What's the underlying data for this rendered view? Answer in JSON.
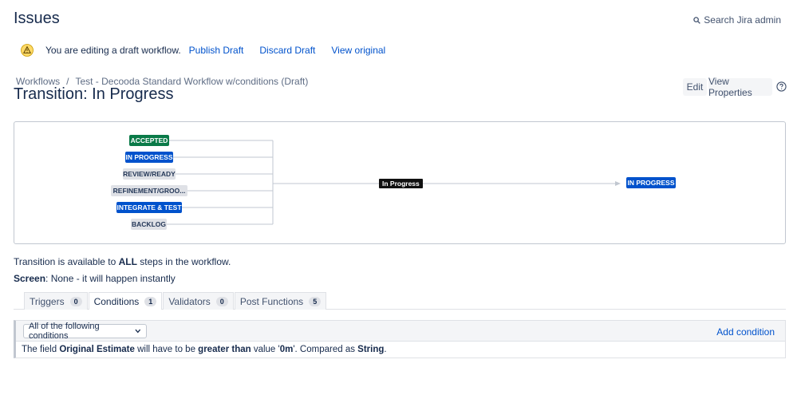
{
  "header": {
    "title": "Issues",
    "search_label": "Search Jira admin"
  },
  "draft": {
    "message": "You are editing a draft workflow.",
    "publish": "Publish Draft",
    "discard": "Discard Draft",
    "view_original": "View original"
  },
  "breadcrumb": {
    "items": [
      "Workflows",
      "Test - Decooda Standard Workflow w/conditions (Draft)"
    ],
    "separator": "/"
  },
  "transition": {
    "title": "Transition: In Progress"
  },
  "actions": {
    "edit": "Edit",
    "view_properties": "View Properties"
  },
  "diagram": {
    "from_steps": [
      {
        "label": "ACCEPTED",
        "color": "green"
      },
      {
        "label": "IN PROGRESS",
        "color": "blue"
      },
      {
        "label": "REVIEW/READY",
        "color": "grey"
      },
      {
        "label": "REFINEMENT/GROO...",
        "color": "grey"
      },
      {
        "label": "INTEGRATE & TEST",
        "color": "blue"
      },
      {
        "label": "BACKLOG",
        "color": "grey"
      }
    ],
    "transition_label": "In Progress",
    "to_step": {
      "label": "IN PROGRESS",
      "color": "blue"
    }
  },
  "info": {
    "available_prefix": "Transition is available to ",
    "available_bold": "ALL",
    "available_suffix": " steps in the workflow.",
    "screen_label": "Screen",
    "screen_value": ": None - it will happen instantly"
  },
  "tabs": [
    {
      "label": "Triggers",
      "count": "0"
    },
    {
      "label": "Conditions",
      "count": "1"
    },
    {
      "label": "Validators",
      "count": "0"
    },
    {
      "label": "Post Functions",
      "count": "5"
    }
  ],
  "conditions": {
    "select_value": "All of the following conditions",
    "add_label": "Add condition",
    "row": {
      "t1": "The field ",
      "b1": "Original Estimate",
      "t2": " will have to be ",
      "b2": "greater than",
      "t3": " value '",
      "b3": "0m",
      "t4": "'. Compared as ",
      "b4": "String",
      "t5": "."
    }
  },
  "colors": {
    "link": "#0052cc",
    "green": "#0a7a48",
    "blue": "#0052cc",
    "grey": "#dfe1e6",
    "text": "#172b4d"
  }
}
